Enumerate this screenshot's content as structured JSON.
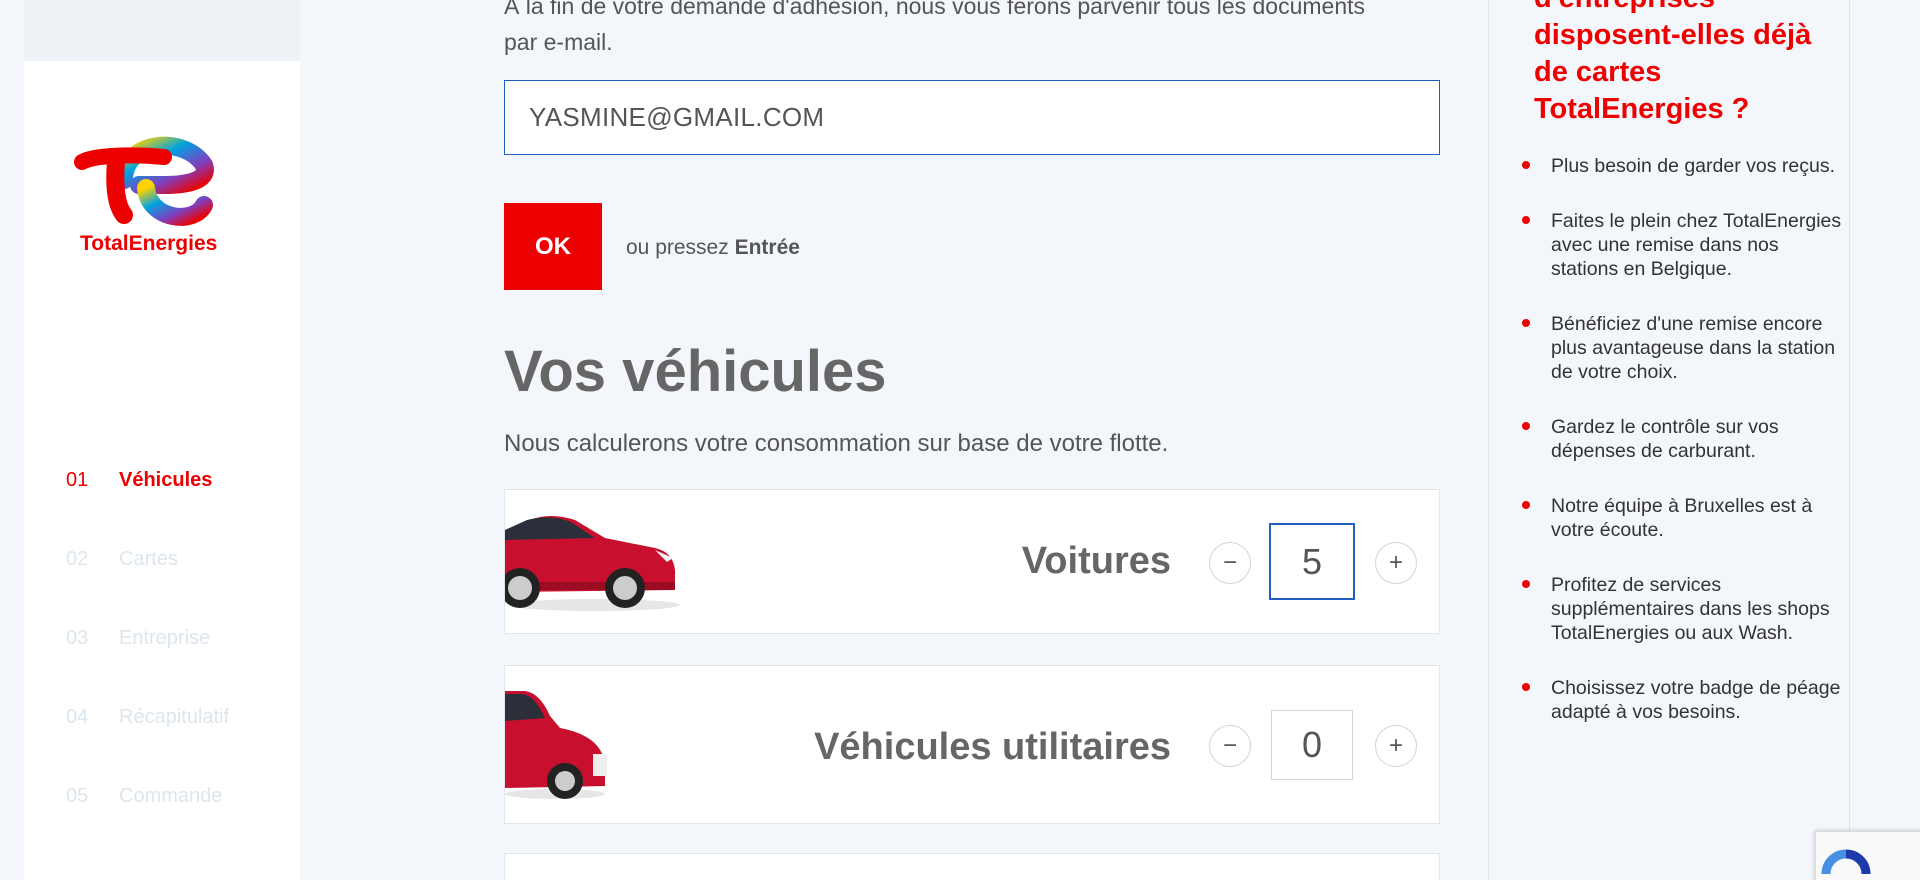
{
  "brand": {
    "name": "TotalEnergies",
    "accent": "#ed0000",
    "focus": "#1f5fbf"
  },
  "steps": [
    {
      "num": "01",
      "label": "Véhicules",
      "active": true
    },
    {
      "num": "02",
      "label": "Cartes",
      "active": false
    },
    {
      "num": "03",
      "label": "Entreprise",
      "active": false
    },
    {
      "num": "04",
      "label": "Récapitulatif",
      "active": false
    },
    {
      "num": "05",
      "label": "Commande",
      "active": false
    }
  ],
  "form": {
    "intro": "À la fin de votre demande d'adhésion, nous vous ferons parvenir tous les documents par e-mail.",
    "email_value": "YASMINE@GMAIL.COM",
    "ok_label": "OK",
    "hint_prefix": "ou pressez",
    "hint_key": "Entrée"
  },
  "vehicles": {
    "title": "Vos véhicules",
    "subtitle": "Nous calculerons votre consommation sur base de votre flotte.",
    "items": [
      {
        "label": "Voitures",
        "qty": "5",
        "minus": "−",
        "plus": "+"
      },
      {
        "label": "Véhicules utilitaires",
        "qty": "0",
        "minus": "−",
        "plus": "+"
      }
    ]
  },
  "sidebar_right": {
    "title": "d'entreprises disposent-elles déjà de cartes TotalEnergies ?",
    "items": [
      "Plus besoin de garder vos reçus.",
      "Faites le plein chez TotalEnergies avec une remise dans nos stations en Belgique.",
      "Bénéficiez d'une remise encore plus avantageuse dans la station de votre choix.",
      "Gardez le contrôle sur vos dépenses de carburant.",
      "Notre équipe à Bruxelles est à votre écoute.",
      "Profitez de services supplémentaires dans les shops TotalEnergies ou aux Wash.",
      "Choisissez votre badge de péage adapté à vos besoins."
    ]
  }
}
